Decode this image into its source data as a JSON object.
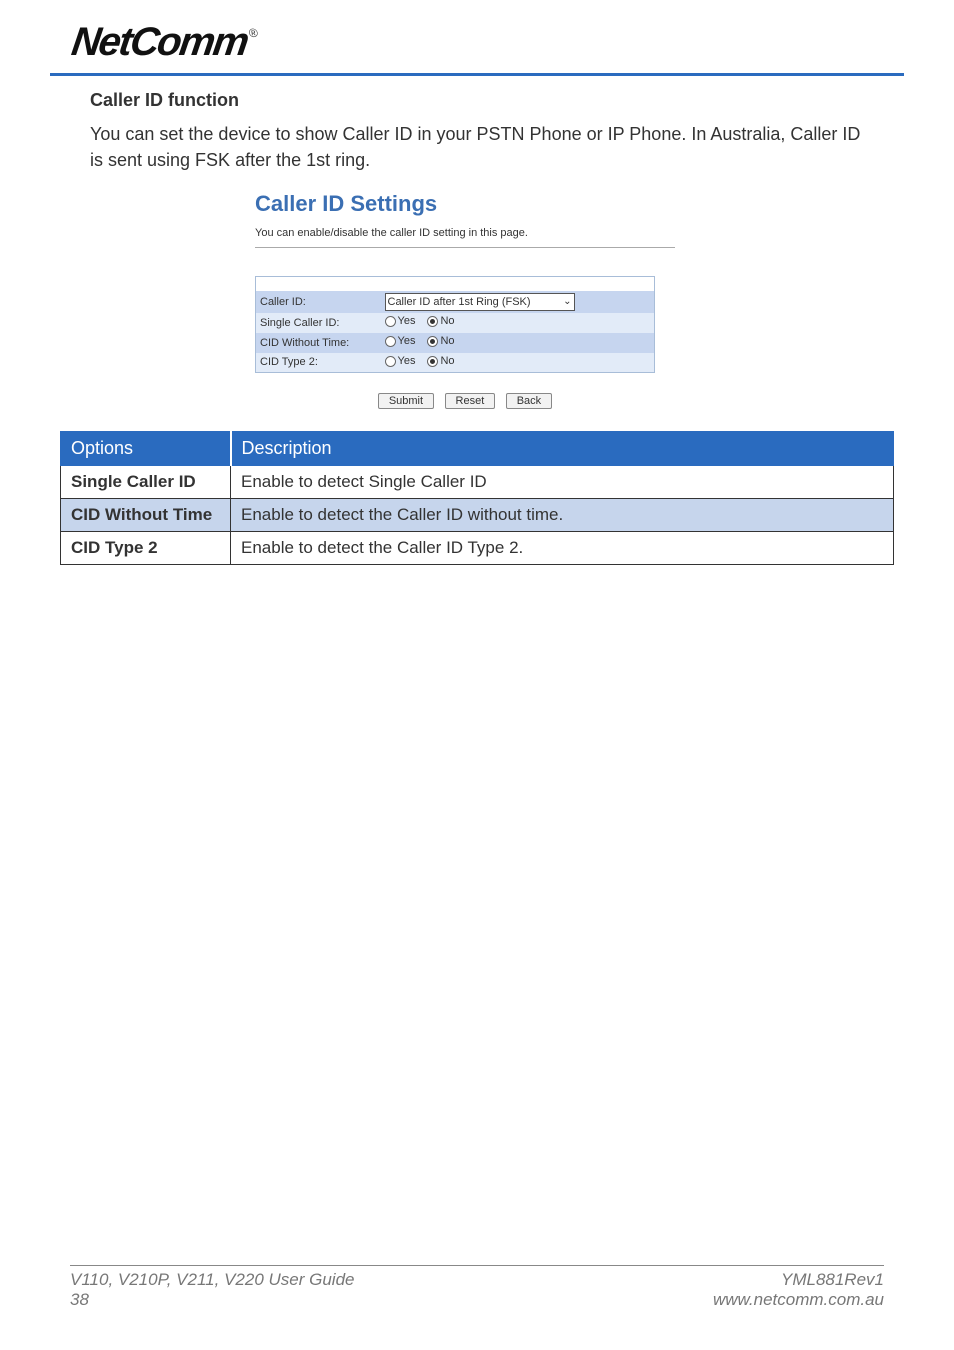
{
  "brand": "NetComm",
  "section": {
    "heading": "Caller ID function",
    "paragraph": "You can set the device to show Caller ID in your PSTN Phone or IP Phone. In Australia, Caller ID is sent using FSK after the 1st ring."
  },
  "ui": {
    "title": "Caller ID Settings",
    "subtitle": "You can enable/disable the caller ID setting in this page.",
    "rows": [
      {
        "label": "Caller ID:",
        "select": "Caller ID after 1st Ring (FSK)"
      },
      {
        "label": "Single Caller ID:",
        "yes": "Yes",
        "no": "No"
      },
      {
        "label": "CID Without Time:",
        "yes": "Yes",
        "no": "No"
      },
      {
        "label": "CID Type 2:",
        "yes": "Yes",
        "no": "No"
      }
    ],
    "buttons": {
      "submit": "Submit",
      "reset": "Reset",
      "back": "Back"
    }
  },
  "opt": {
    "head": {
      "c0": "Options",
      "c1": "Description"
    },
    "rows": [
      {
        "c0": "Single Caller ID",
        "c1": "Enable to detect Single Caller ID"
      },
      {
        "c0": "CID Without Time",
        "c1": "Enable to detect the Caller ID without time."
      },
      {
        "c0": "CID Type 2",
        "c1": "Enable to detect the Caller ID Type 2."
      }
    ]
  },
  "footer": {
    "left1": "V110, V210P, V211, V220 User Guide",
    "left2": "38",
    "right1": "YML881Rev1",
    "right2": "www.netcomm.com.au"
  }
}
